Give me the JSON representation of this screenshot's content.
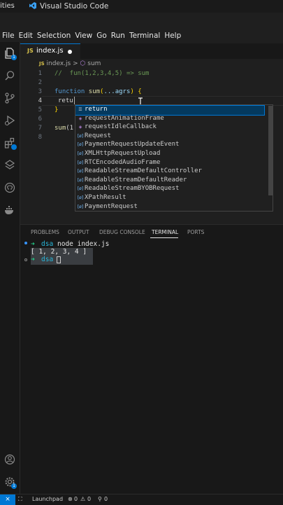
{
  "topbar": {
    "app_menu": "ities",
    "window_title": "Visual Studio Code"
  },
  "menubar": [
    "File",
    "Edit",
    "Selection",
    "View",
    "Go",
    "Run",
    "Terminal",
    "Help"
  ],
  "activity": {
    "explorer_badge": "1",
    "accounts_badge": "",
    "settings_badge": "1"
  },
  "tab": {
    "icon": "JS",
    "name": "index.js"
  },
  "breadcrumb": {
    "file": "index.js",
    "sep": ">",
    "symbol": "sum"
  },
  "editor": {
    "line_numbers": [
      "1",
      "2",
      "3",
      "4",
      "5",
      "6",
      "7",
      "8"
    ],
    "line1": "//  fun(1,2,3,4,5) => sum",
    "line3_kw": "function",
    "line3_fn": "sum",
    "line3_rest": "(",
    "line3_param": "...agrs",
    "line3_close": ") {",
    "line4": "retu",
    "line5": "}",
    "line7_fn": "sum",
    "line7_rest": "(1"
  },
  "suggestions": [
    {
      "icon": "keyword-icon",
      "label": "return"
    },
    {
      "icon": "method-icon",
      "label": "requestAnimationFrame"
    },
    {
      "icon": "method-icon",
      "label": "requestIdleCallback"
    },
    {
      "icon": "variable-icon",
      "label": "Request"
    },
    {
      "icon": "variable-icon",
      "label": "PaymentRequestUpdateEvent"
    },
    {
      "icon": "variable-icon",
      "label": "XMLHttpRequestUpload"
    },
    {
      "icon": "variable-icon",
      "label": "RTCEncodedAudioFrame"
    },
    {
      "icon": "variable-icon",
      "label": "ReadableStreamDefaultController"
    },
    {
      "icon": "variable-icon",
      "label": "ReadableStreamDefaultReader"
    },
    {
      "icon": "variable-icon",
      "label": "ReadableStreamBYOBRequest"
    },
    {
      "icon": "variable-icon",
      "label": "XPathResult"
    },
    {
      "icon": "variable-icon",
      "label": "PaymentRequest"
    }
  ],
  "panel": {
    "tabs": [
      "PROBLEMS",
      "OUTPUT",
      "DEBUG CONSOLE",
      "TERMINAL",
      "PORTS"
    ],
    "active_tab": "TERMINAL"
  },
  "terminal": {
    "prompt_arrow": "➜",
    "dir": "dsa",
    "command": "node index.js",
    "output": "[ 1, 2, 3, 4 ]"
  },
  "status": {
    "launchpad": "Launchpad",
    "errors": "0",
    "warnings": "0",
    "ports": "0"
  },
  "colors": {
    "accent": "#0078d4",
    "background": "#1f1f1f",
    "terminal_green": "#23d18b",
    "terminal_cyan": "#29b8db"
  }
}
